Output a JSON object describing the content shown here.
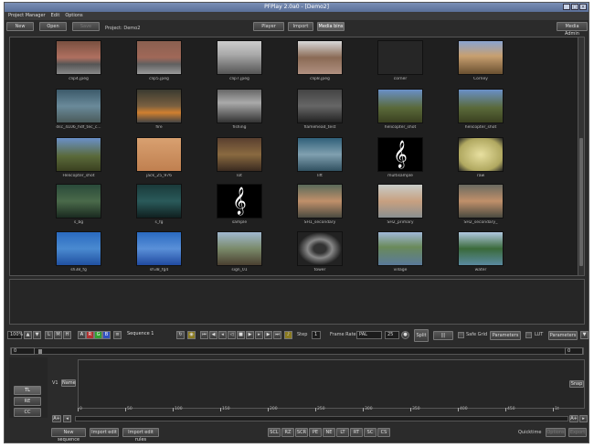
{
  "window": {
    "title": "PFPlay 2.0a0 - [Demo2]"
  },
  "menu": [
    "Project Manager",
    "Edit",
    "Options"
  ],
  "toolbar": {
    "new": "New",
    "open": "Open",
    "save": "Save",
    "project": "Project: Demo2",
    "player": "Player",
    "import": "Import",
    "media_bins": "Media bins",
    "media_admin": "Media Admin"
  },
  "media": [
    {
      "caption": "clip4.jpeg",
      "color": "linear-gradient(#7a5040,#b07060 50%,#555 70%,#888)"
    },
    {
      "caption": "clip5.jpeg",
      "color": "linear-gradient(#8a6050,#a06858 50%,#606060 70%,#999)"
    },
    {
      "caption": "clip7.jpeg",
      "color": "linear-gradient(#ccc,#aaa 40%,#555)"
    },
    {
      "caption": "clip8.jpeg",
      "color": "linear-gradient(#d8d8d8,#8a6a55 50%,#b09080)"
    },
    {
      "caption": "corner",
      "color": "#262626"
    },
    {
      "caption": "Corney",
      "color": "linear-gradient(#8aa4d0,#c8a070 45%,#6a5030)"
    },
    {
      "caption": "dsc_4106_hdf_tec_c...",
      "color": "linear-gradient(#3c5a6a,#6a8a9a 50%,#4a5a5a)"
    },
    {
      "caption": "fire",
      "color": "linear-gradient(#3a3a30,#7a6040 50%,#d08030 70%,#444)"
    },
    {
      "caption": "fishing",
      "color": "linear-gradient(#666,#aaa 40%,#333)"
    },
    {
      "caption": "flamehead_test",
      "color": "linear-gradient(#444,#666 50%,#222)"
    },
    {
      "caption": "helicopter_shot",
      "color": "linear-gradient(#6a90c8,#5a6a3a 55%,#3a4020)"
    },
    {
      "caption": "helicopter_shot",
      "color": "linear-gradient(#6a90c8,#5a6a3a 55%,#3a4020)"
    },
    {
      "caption": "Helicopter_shot",
      "color": "linear-gradient(#6a90c8,#5a6a3a 55%,#3a4020)"
    },
    {
      "caption": "jack_25_976",
      "color": "linear-gradient(#d8a070,#c08050)"
    },
    {
      "caption": "lot",
      "color": "linear-gradient(#5a4030,#8a6a40 50%,#3a2a20)"
    },
    {
      "caption": "lift",
      "color": "linear-gradient(#30607a,#80a0b0 50%,#305060)"
    },
    {
      "caption": "multisample",
      "color": "#000",
      "clef": "𝄞"
    },
    {
      "caption": "raw",
      "color": "radial-gradient(#e8e0a0,#b0a860 70%,#222)"
    },
    {
      "caption": "s_bg",
      "color": "linear-gradient(#2a4a3a,#4a6a4a 50%,#1a2a20)"
    },
    {
      "caption": "s_fg",
      "color": "linear-gradient(#1a3a3a,#2a5a5a 50%,#102020)"
    },
    {
      "caption": "sample",
      "color": "#000",
      "clef": "𝄞"
    },
    {
      "caption": "SH1_secondary",
      "color": "linear-gradient(#5a6a5a,#c0906a 50%,#4a4a40)"
    },
    {
      "caption": "SH2_primary",
      "color": "linear-gradient(#c8ccc8,#c8a080 50%,#8a9090)"
    },
    {
      "caption": "SH2_secondary_",
      "color": "linear-gradient(#6a6a60,#c0906a 50%,#4a4a40)"
    },
    {
      "caption": "sh38_fg",
      "color": "linear-gradient(#2a6ac0,#4a8ad0 50%,#2050a0)"
    },
    {
      "caption": "sh38_fg4",
      "color": "linear-gradient(#2a6ac0,#5a90d8 50%,#204aa0)"
    },
    {
      "caption": "sign_01",
      "color": "linear-gradient(#a0b8d0,#7a8a6a 50%,#4a4030)"
    },
    {
      "caption": "tower",
      "color": "radial-gradient(#333 20%,#888 40%,#222 70%)"
    },
    {
      "caption": "village",
      "color": "linear-gradient(#a0b8d8,#6a8a5a 45%,#5a7a9a)"
    },
    {
      "caption": "water",
      "color": "linear-gradient(#b0c8e0,#3a6a3a 50%,#5a8aa0)"
    }
  ],
  "player": {
    "zoom": "100%",
    "sequence": "Sequence 1",
    "step_label": "Step",
    "step_value": "1",
    "frame_rate_label": "Frame Rate",
    "frame_rate": "PAL",
    "fps": "25",
    "split": "Split",
    "safe_grid": "Safe Grid",
    "parameters": "Parameters",
    "lut": "LUT",
    "parameters2": "Parameters",
    "channels": [
      "A",
      "R",
      "G",
      "B"
    ]
  },
  "timeline": {
    "tabs": [
      "TL",
      "RE",
      "CC"
    ],
    "track": "V1",
    "track_btn": "Name",
    "snap": "Snap",
    "ticks": [
      "0",
      "50",
      "100",
      "150",
      "200",
      "250",
      "300",
      "350",
      "400",
      "450",
      "1t"
    ],
    "nav_left": "A+",
    "nav_right": "A+"
  },
  "bottom": {
    "new_sequence": "New sequence",
    "import_edit": "Import edit",
    "import_edit_rules": "Import edit rules",
    "tools": [
      "SCL",
      "RZ",
      "SCR",
      "PE",
      "NE",
      "LT",
      "RT",
      "SC",
      "CS"
    ],
    "quicktime": "Quicktime",
    "options": "Options",
    "export": "Export"
  },
  "slider": {
    "start": "0",
    "end": "0"
  }
}
